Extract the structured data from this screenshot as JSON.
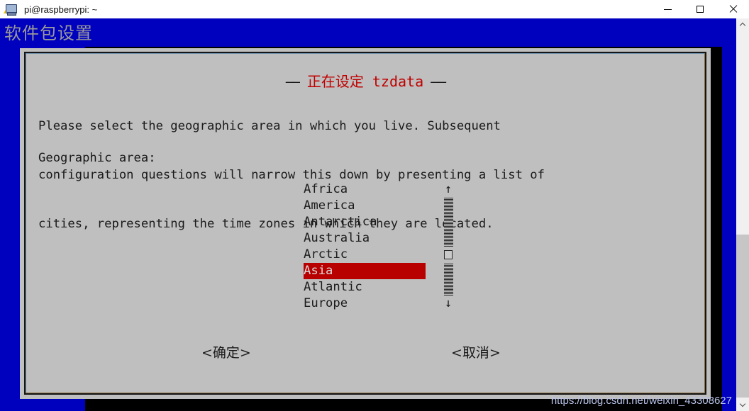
{
  "window": {
    "icon": "putty-terminal-icon",
    "title": "pi@raspberrypi: ~",
    "controls": {
      "minimize": "minimize-icon",
      "maximize": "maximize-icon",
      "close": "close-icon"
    }
  },
  "backdrop": {
    "heading": "软件包设置"
  },
  "dialog": {
    "title": "正在设定 tzdata",
    "dash_left": "——",
    "dash_right": "——",
    "body_lines": [
      "Please select the geographic area in which you live. Subsequent",
      "configuration questions will narrow this down by presenting a list of",
      "cities, representing the time zones in which they are located."
    ],
    "field_label": "Geographic area:",
    "list": {
      "items": [
        {
          "label": "Africa",
          "selected": false
        },
        {
          "label": "America",
          "selected": false
        },
        {
          "label": "Antarctica",
          "selected": false
        },
        {
          "label": "Australia",
          "selected": false
        },
        {
          "label": "Arctic",
          "selected": false
        },
        {
          "label": "Asia",
          "selected": true
        },
        {
          "label": "Atlantic",
          "selected": false
        },
        {
          "label": "Europe",
          "selected": false
        }
      ],
      "selected_value": "Asia",
      "scroll_up_arrow": "↑",
      "scroll_down_arrow": "↓"
    },
    "buttons": {
      "ok": "<确定>",
      "cancel": "<取消>"
    }
  },
  "watermark": "https://blog.csdn.net/weixin_43308627",
  "colors": {
    "terminal_blue": "#0000bf",
    "terminal_black": "#000000",
    "dialog_gray": "#bfbfbf",
    "title_red": "#c00000",
    "selection_red": "#b80000",
    "selection_text": "#d8d8d8",
    "text_dark": "#1b1b1b",
    "backdrop_heading": "#9a9a9a",
    "watermark": "#b9c4ea"
  }
}
